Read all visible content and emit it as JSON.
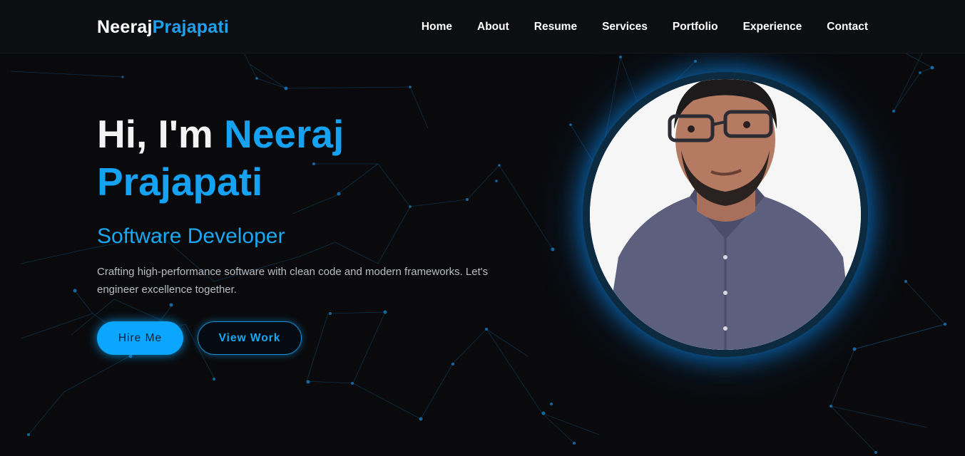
{
  "brand": {
    "first": "Neeraj",
    "last": "Prajapati"
  },
  "nav": {
    "items": [
      "Home",
      "About",
      "Resume",
      "Services",
      "Portfolio",
      "Experience",
      "Contact"
    ]
  },
  "hero": {
    "greeting": "Hi, I'm ",
    "name_first": "Neeraj",
    "name_last": "Prajapati",
    "role": "Software Developer",
    "description": "Crafting high-performance software with clean code and modern frameworks. Let's engineer excellence together.",
    "hire_label": "Hire Me",
    "work_label": "View Work"
  },
  "colors": {
    "accent": "#0aa6ff",
    "background": "#0a0a0c",
    "navbar": "#0d0e12"
  },
  "icons": {
    "avatar": "profile-photo"
  }
}
